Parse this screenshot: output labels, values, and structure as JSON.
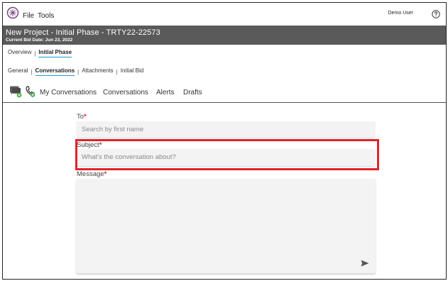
{
  "menu": {
    "file": "File",
    "tools": "Tools",
    "user": "Demo User"
  },
  "project": {
    "title": "New Project - Initial Phase - TRTY22-22573",
    "bid_date": "Current Bid Date: Jun 23, 2022"
  },
  "phase_tabs": {
    "overview": "Overview",
    "separator": "|",
    "initial_phase": "Initial Phase"
  },
  "section_tabs": {
    "general": "General",
    "conversations": "Conversations",
    "attachments": "Attachments",
    "initial_bid": "Initial Bid",
    "separator": "|"
  },
  "conv_toolbar": {
    "my_conversations": "My Conversations",
    "conversations": "Conversations",
    "alerts": "Alerts",
    "drafts": "Drafts"
  },
  "form": {
    "to_label": "To",
    "to_placeholder": "Search by first name",
    "subject_label": "Subject",
    "subject_placeholder": "What's the conversation about?",
    "message_label": "Message",
    "required_mark": "*"
  },
  "colors": {
    "header_bg": "#5a5a5a",
    "accent_blue": "#1a9ad6",
    "required_red": "#e0232b",
    "highlight_red": "#e0232b",
    "icon_green": "#4caf50"
  },
  "icons": {
    "logo": "logo-icon",
    "help": "help-circle-icon",
    "chat": "chat-bubbles-icon",
    "phone": "phone-icon",
    "send": "send-icon"
  }
}
